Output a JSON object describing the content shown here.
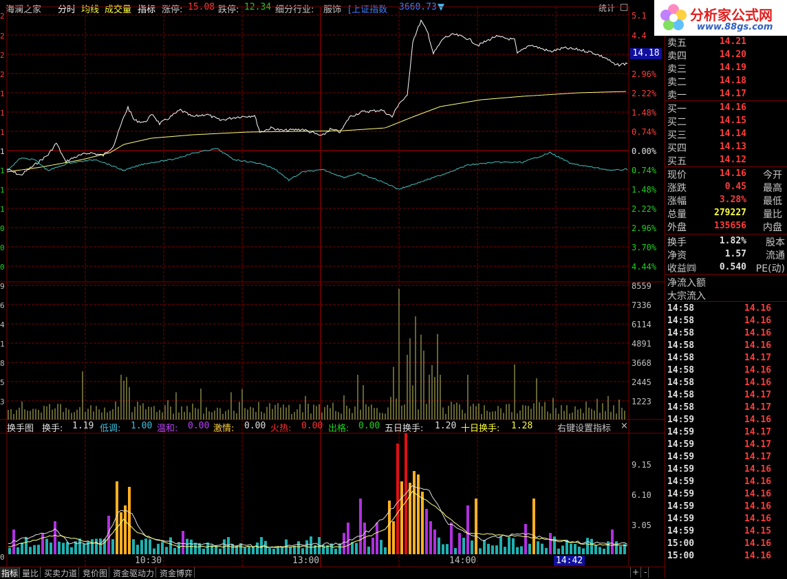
{
  "header": {
    "site_name": "海澜之家",
    "tabs": [
      "分时",
      "均线",
      "成交量",
      "指标"
    ],
    "limit_up_label": "涨停:",
    "limit_up_value": "15.08",
    "limit_down_label": "跌停:",
    "limit_down_value": "12.34",
    "industry_label": "细分行业:",
    "industry_value": "服饰",
    "index_label": "[上证指数",
    "index_value": "3660.73",
    "index_arrow": "▼",
    "stat_button": "统计",
    "close_glyph": "□"
  },
  "logo": {
    "title": "分析家公式网",
    "url": "www.88gs.com"
  },
  "price_axis": {
    "right_labels": [
      "5.1",
      "4.4",
      "",
      "2.96%",
      "2.22%",
      "1.48%",
      "0.74%",
      "0.00%",
      "0.74%",
      "1.48%",
      "2.22%",
      "2.96%",
      "3.70%",
      "4.44%"
    ],
    "current_price_box": "14.18",
    "left_edge_digits": [
      "2",
      "2",
      "2",
      "2",
      "1",
      "1",
      "1",
      "1",
      "1",
      "1",
      "1",
      "0",
      "0",
      "0"
    ]
  },
  "volume_axis": {
    "right_labels": [
      "8559",
      "7336",
      "6114",
      "4891",
      "3668",
      "2445",
      "1223"
    ],
    "left_edge_digits": [
      "9",
      "6",
      "4",
      "1",
      "8",
      "5",
      "3"
    ]
  },
  "indicator": {
    "legend": {
      "name": "换手图",
      "turnover_label": "换手:",
      "turnover_value": "1.19",
      "low_label": "低调:",
      "low_value": "1.00",
      "mild_label": "温和:",
      "mild_value": "0.00",
      "passion_label": "激情:",
      "passion_value": "0.00",
      "hot_label": "火热:",
      "hot_value": "0.00",
      "break_label": "出格:",
      "break_value": "0.00",
      "five_label": "五日换手:",
      "five_value": "1.20",
      "ten_label": "十日换手:",
      "ten_value": "1.28",
      "settings": "右键设置指标",
      "close": "×"
    },
    "right_labels": [
      "9.15",
      "6.10",
      "3.05"
    ],
    "left_edge_digit": "0"
  },
  "time_axis": {
    "labels": [
      "10:30",
      "13:00",
      "14:00"
    ],
    "cursor_time": "14:42"
  },
  "bottom_tabs": [
    "指标",
    "量比",
    "买卖力道",
    "竞价图",
    "资金驱动力",
    "资金博弈"
  ],
  "bottom_controls": [
    "+",
    "-"
  ],
  "order_book": {
    "asks": [
      {
        "label": "卖五",
        "price": "14.21"
      },
      {
        "label": "卖四",
        "price": "14.20"
      },
      {
        "label": "卖三",
        "price": "14.19"
      },
      {
        "label": "卖二",
        "price": "14.18"
      },
      {
        "label": "卖一",
        "price": "14.17"
      }
    ],
    "bids": [
      {
        "label": "买一",
        "price": "14.16"
      },
      {
        "label": "买二",
        "price": "14.15"
      },
      {
        "label": "买三",
        "price": "14.14"
      },
      {
        "label": "买四",
        "price": "14.13"
      },
      {
        "label": "买五",
        "price": "14.12"
      }
    ]
  },
  "quote": [
    {
      "label": "现价",
      "value": "14.16",
      "label2": "今开",
      "color": "red"
    },
    {
      "label": "涨跌",
      "value": "0.45",
      "label2": "最高",
      "color": "red"
    },
    {
      "label": "涨幅",
      "value": "3.28%",
      "label2": "最低",
      "color": "red"
    },
    {
      "label": "总量",
      "value": "279227",
      "label2": "量比",
      "color": "yellow"
    },
    {
      "label": "外盘",
      "value": "135656",
      "label2": "内盘",
      "color": "red"
    }
  ],
  "stats": [
    {
      "label": "换手",
      "value": "1.82%",
      "label2": "股本"
    },
    {
      "label": "净资",
      "value": "1.57",
      "label2": "流通"
    },
    {
      "label": "收益㈣",
      "value": "0.540",
      "label2": "PE(动)"
    }
  ],
  "flows": [
    "净流入额",
    "大宗流入"
  ],
  "ticks": [
    {
      "time": "14:58",
      "price": "14.16"
    },
    {
      "time": "14:58",
      "price": "14.16"
    },
    {
      "time": "14:58",
      "price": "14.16"
    },
    {
      "time": "14:58",
      "price": "14.16"
    },
    {
      "time": "14:58",
      "price": "14.17"
    },
    {
      "time": "14:58",
      "price": "14.16"
    },
    {
      "time": "14:58",
      "price": "14.16"
    },
    {
      "time": "14:58",
      "price": "14.17"
    },
    {
      "time": "14:58",
      "price": "14.17"
    },
    {
      "time": "14:59",
      "price": "14.16"
    },
    {
      "time": "14:59",
      "price": "14.17"
    },
    {
      "time": "14:59",
      "price": "14.17"
    },
    {
      "time": "14:59",
      "price": "14.17"
    },
    {
      "time": "14:59",
      "price": "14.16"
    },
    {
      "time": "14:59",
      "price": "14.16"
    },
    {
      "time": "14:59",
      "price": "14.16"
    },
    {
      "time": "14:59",
      "price": "14.16"
    },
    {
      "time": "14:59",
      "price": "14.16"
    },
    {
      "time": "14:59",
      "price": "14.15"
    },
    {
      "time": "15:00",
      "price": "14.16"
    },
    {
      "time": "15:00",
      "price": "14.16"
    }
  ],
  "colors": {
    "grid": "#7a0000",
    "price_line": "#ffffff",
    "avg_line": "#ffff80",
    "index_line": "#40c0c0",
    "volume_bar": "#c8c864",
    "bar_cyan": "#20b0b0",
    "bar_purple": "#b030e0",
    "bar_orange": "#ffb020",
    "bar_red": "#e01010",
    "ma_line": "#e0e0e0",
    "ma_line2": "#ffff80"
  }
}
